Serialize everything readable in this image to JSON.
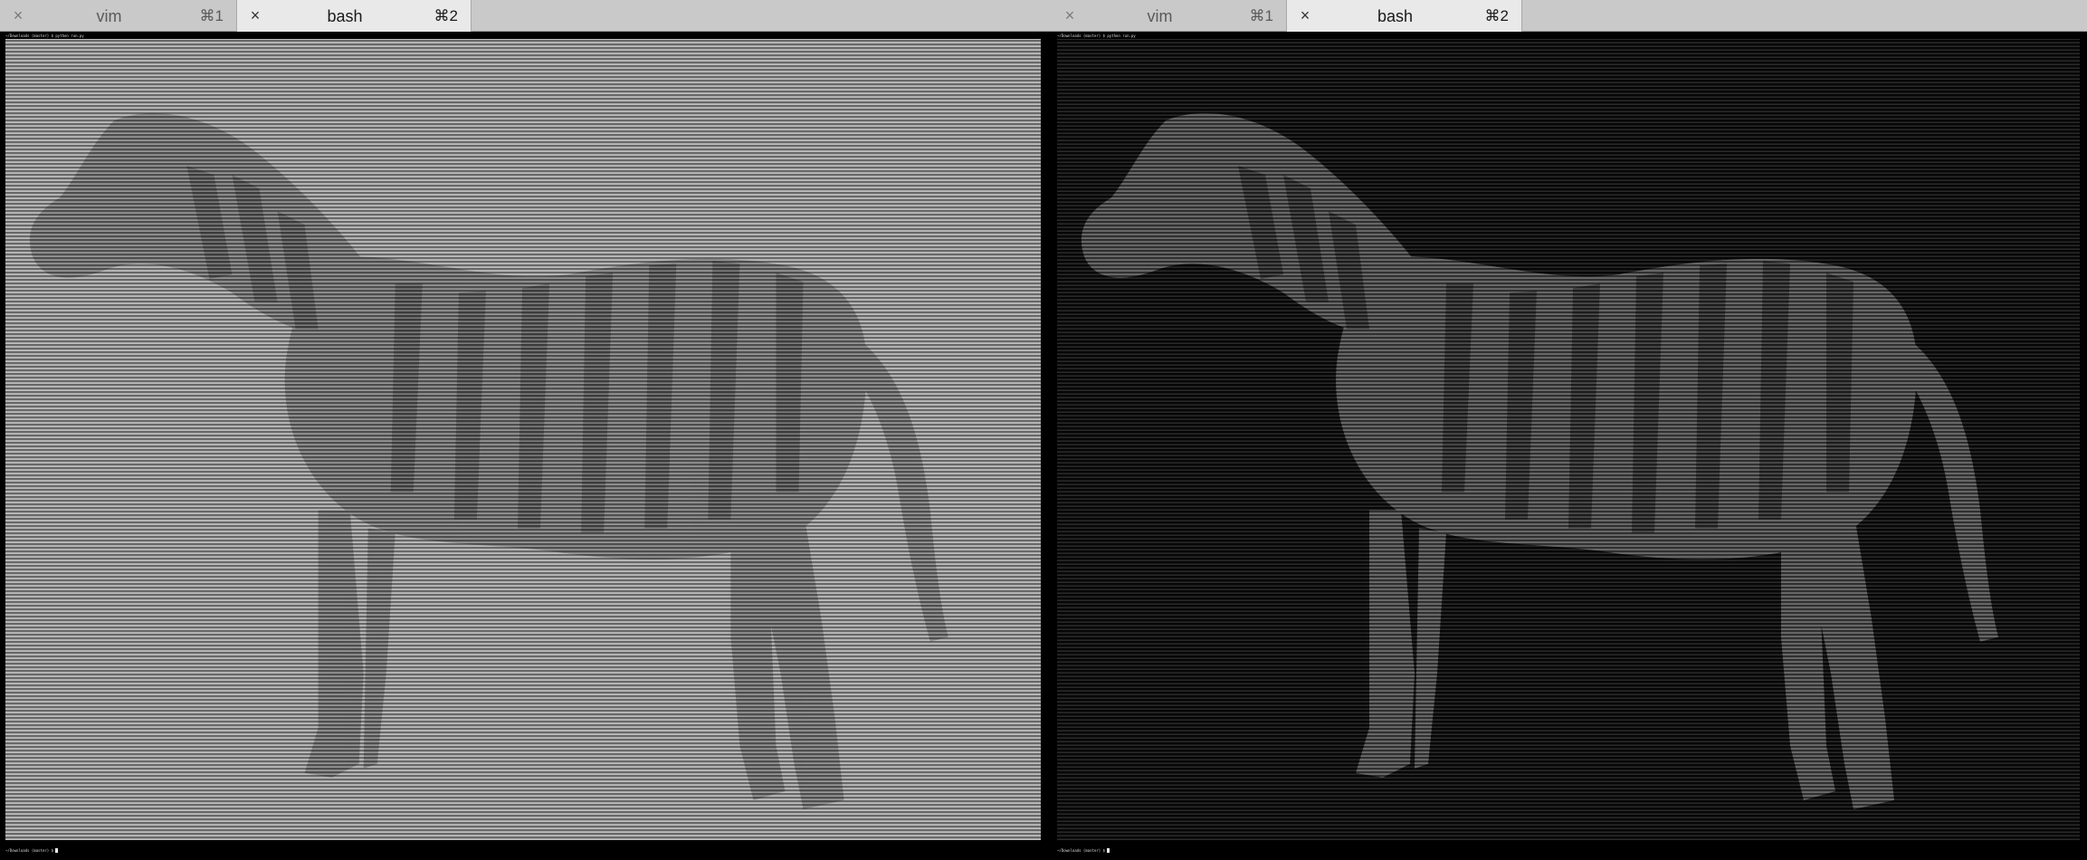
{
  "windows": [
    {
      "tabs": [
        {
          "title": "vim",
          "shortcut": "⌘1",
          "active": false
        },
        {
          "title": "bash",
          "shortcut": "⌘2",
          "active": true
        }
      ],
      "prompt_top": "~/Downloads (master) $ python run.py",
      "prompt_bottom": "~/Downloads (master) $",
      "image_theme": "light"
    },
    {
      "tabs": [
        {
          "title": "vim",
          "shortcut": "⌘1",
          "active": false
        },
        {
          "title": "bash",
          "shortcut": "⌘2",
          "active": true
        }
      ],
      "prompt_top": "~/Downloads (master) $ python run.py",
      "prompt_bottom": "~/Downloads (master) $",
      "image_theme": "dark"
    }
  ],
  "colors": {
    "tabbar_bg": "#c9c9c9",
    "active_tab_bg": "#e9e9e9",
    "left_screen_bg": "#9d9d9d",
    "right_screen_bg": "#111111"
  },
  "icons": {
    "tab_close": "close-icon"
  }
}
